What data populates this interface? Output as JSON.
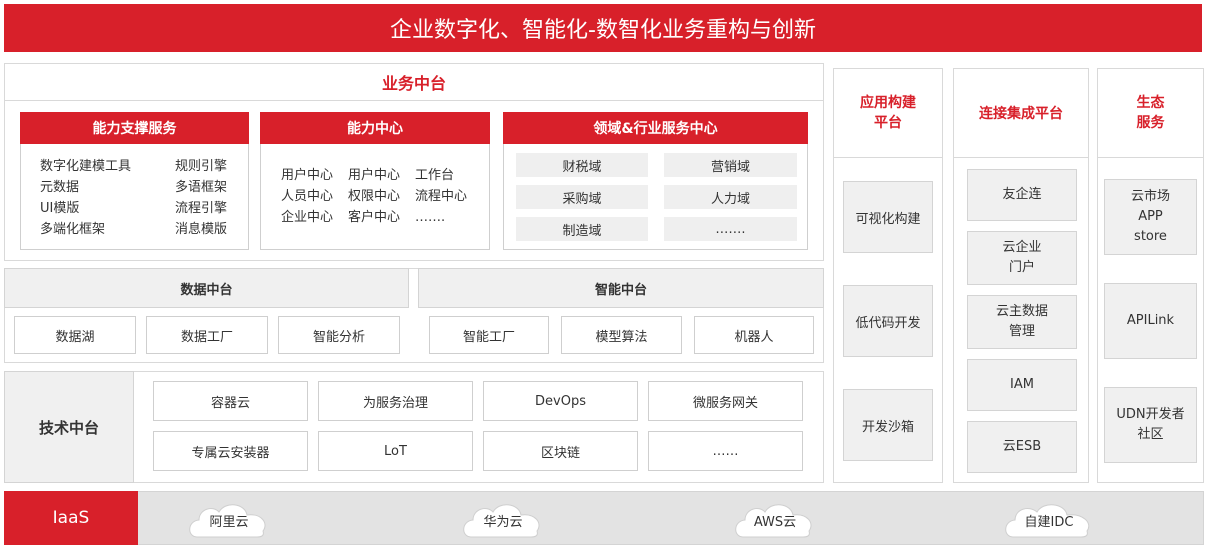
{
  "title": "企业数字化、智能化-数智化业务重构与创新",
  "business": {
    "title": "业务中台",
    "capability_support": {
      "title": "能力支撑服务",
      "left": [
        "数字化建模工具",
        "元数据",
        "UI模版",
        "多端化框架"
      ],
      "right": [
        "规则引擎",
        "多语框架",
        "流程引擎",
        "消息模版"
      ]
    },
    "capability_center": {
      "title": "能力中心",
      "rows": [
        [
          "用户中心",
          "用户中心",
          "工作台"
        ],
        [
          "人员中心",
          "权限中心",
          "流程中心"
        ],
        [
          "企业中心",
          "客户中心",
          "……."
        ]
      ]
    },
    "domain_center": {
      "title": "领域&行业服务中心",
      "cells": [
        "财税域",
        "营销域",
        "采购域",
        "人力域",
        "制造域",
        "……."
      ]
    }
  },
  "data_platform": {
    "title": "数据中台",
    "items": [
      "数据湖",
      "数据工厂",
      "智能分析"
    ]
  },
  "ai_platform": {
    "title": "智能中台",
    "items": [
      "智能工厂",
      "模型算法",
      "机器人"
    ]
  },
  "tech_platform": {
    "title": "技术中台",
    "items": [
      "容器云",
      "为服务治理",
      "DevOps",
      "微服务网关",
      "专属云安装器",
      "LoT",
      "区块链",
      "……"
    ]
  },
  "iaas": {
    "title": "IaaS",
    "clouds": [
      "阿里云",
      "华为云",
      "AWS云",
      "自建IDC"
    ]
  },
  "app_build": {
    "title": "应用构建\n平台",
    "items": [
      "可视化构建",
      "低代码开发",
      "开发沙箱"
    ]
  },
  "integration": {
    "title": "连接集成平台",
    "items": [
      "友企连",
      "云企业\n门户",
      "云主数据\n管理",
      "IAM",
      "云ESB"
    ]
  },
  "ecosystem": {
    "title": "生态\n服务",
    "items": [
      "云市场\nAPP\nstore",
      "APILink",
      "UDN开发者\n社区"
    ]
  }
}
